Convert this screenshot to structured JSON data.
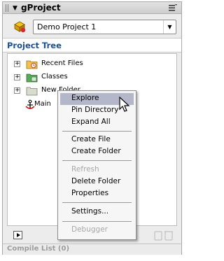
{
  "panel": {
    "title": "gProject"
  },
  "project": {
    "selected": "Demo Project 1"
  },
  "tree": {
    "header": "Project Tree",
    "items": [
      {
        "label": "Recent Files",
        "icon": "recent-folder-icon"
      },
      {
        "label": "Classes",
        "icon": "classes-folder-icon"
      },
      {
        "label": "New Folder",
        "icon": "folder-icon"
      },
      {
        "label": "Main",
        "icon": "anchor-icon"
      }
    ]
  },
  "context_menu": {
    "items": [
      {
        "label": "Explore",
        "state": "highlighted"
      },
      {
        "label": "Pin Directory",
        "state": "enabled"
      },
      {
        "label": "Expand All",
        "state": "enabled"
      },
      {
        "label": "Create File",
        "state": "enabled"
      },
      {
        "label": "Create Folder",
        "state": "enabled"
      },
      {
        "label": "Refresh",
        "state": "disabled"
      },
      {
        "label": "Delete Folder",
        "state": "enabled"
      },
      {
        "label": "Properties",
        "state": "enabled"
      },
      {
        "label": "Settings...",
        "state": "enabled"
      },
      {
        "label": "Debugger",
        "state": "disabled"
      }
    ]
  },
  "compile_list": {
    "label": "Compile List (0)"
  },
  "colors": {
    "tree_header_text": "#1a4f9a",
    "menu_highlight": "#b3b7c9",
    "disabled_text": "#a8a8a8"
  }
}
